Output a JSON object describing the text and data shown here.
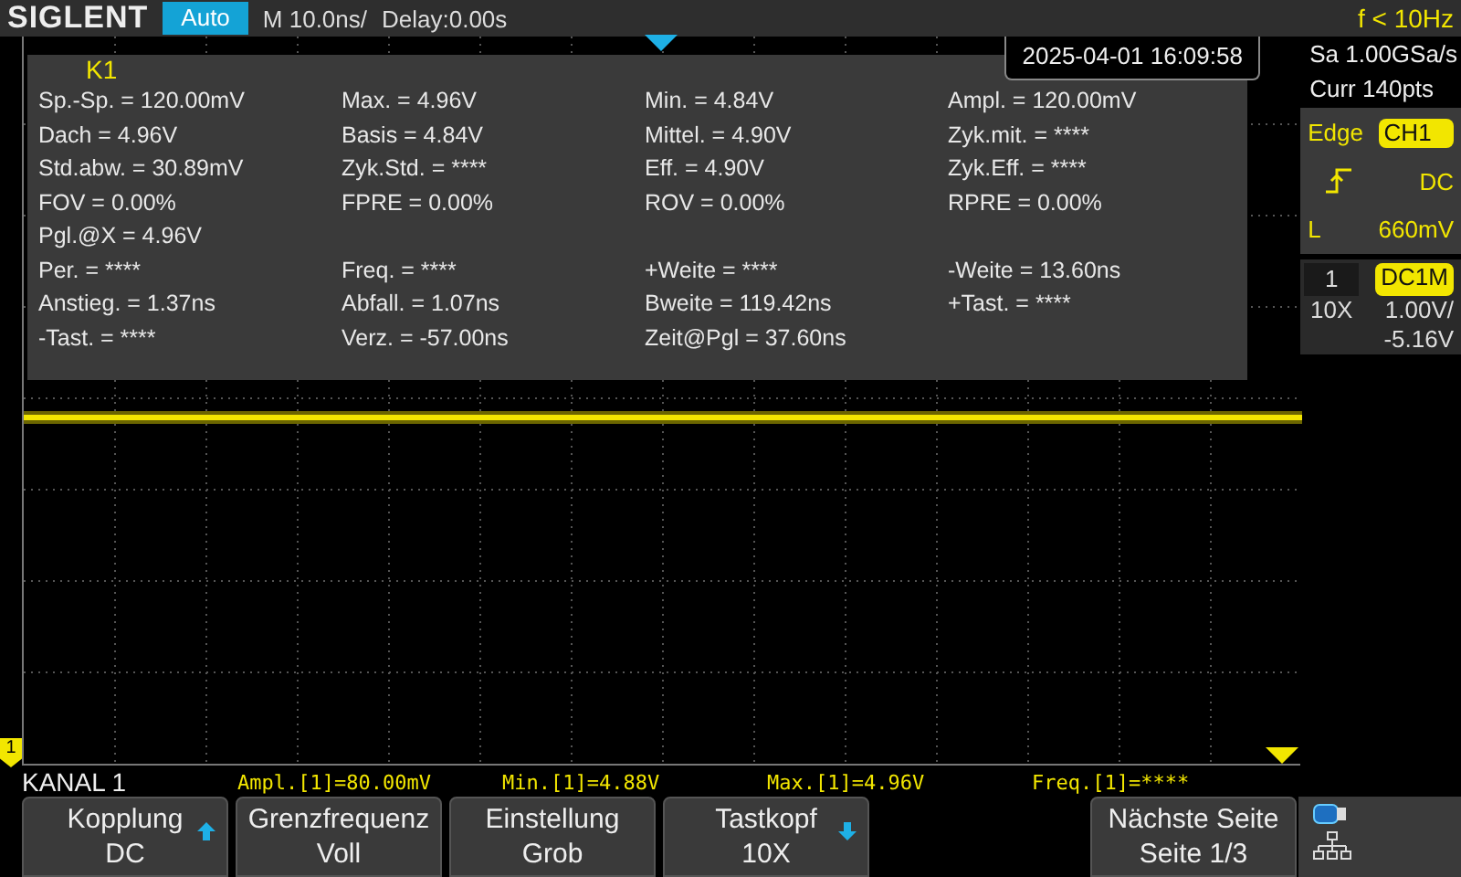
{
  "top_bar": {
    "logo": "SIGLENT",
    "mode": "Auto",
    "timebase": "M 10.0ns/",
    "delay": "Delay:0.00s",
    "frequency": "f < 10Hz"
  },
  "timestamp": "2025-04-01 16:09:58",
  "measurements": {
    "title": "K1",
    "rows": [
      [
        "Sp.-Sp. = 120.00mV",
        "Max. = 4.96V",
        "Min. = 4.84V",
        "Ampl. = 120.00mV"
      ],
      [
        "Dach = 4.96V",
        "Basis = 4.84V",
        "Mittel. = 4.90V",
        "Zyk.mit. = ****"
      ],
      [
        "Std.abw. = 30.89mV",
        "Zyk.Std. = ****",
        "Eff. = 4.90V",
        "Zyk.Eff. = ****"
      ],
      [
        "FOV = 0.00%",
        "FPRE = 0.00%",
        "ROV = 0.00%",
        "RPRE = 0.00%"
      ],
      [
        "Pgl.@X = 4.96V"
      ],
      [
        "Per. = ****",
        "Freq. = ****",
        "+Weite = ****",
        "-Weite = 13.60ns"
      ],
      [
        "Anstieg. = 1.37ns",
        "Abfall. = 1.07ns",
        "Bweite = 119.42ns",
        "+Tast. = ****"
      ],
      [
        "-Tast. = ****",
        "Verz. = -57.00ns",
        "Zeit@Pgl = 37.60ns"
      ]
    ]
  },
  "channel_marker": "1",
  "right_panel": {
    "sample_rate": "Sa 1.00GSa/s",
    "memory": "Curr 140pts",
    "trigger": {
      "type": "Edge",
      "source": "CH1",
      "coupling": "DC",
      "level_label": "L",
      "level": "660mV"
    },
    "channel": {
      "number": "1",
      "coupling": "DC1M",
      "probe": "10X",
      "scale": "1.00V/",
      "offset": "-5.16V"
    }
  },
  "status_bar": {
    "channel": "KANAL 1",
    "readouts": [
      "Ampl.[1]=80.00mV",
      "Min.[1]=4.88V",
      "Max.[1]=4.96V",
      "Freq.[1]=****"
    ]
  },
  "softkeys": [
    {
      "kind": "menu",
      "label": "Kopplung",
      "value": "DC",
      "arrow_up": true,
      "arrow_down": false
    },
    {
      "kind": "menu",
      "label": "Grenzfrequenz",
      "value": "Voll",
      "arrow_up": false,
      "arrow_down": false
    },
    {
      "kind": "menu",
      "label": "Einstellung",
      "value": "Grob",
      "arrow_up": false,
      "arrow_down": false
    },
    {
      "kind": "menu",
      "label": "Tastkopf",
      "value": "10X",
      "arrow_up": false,
      "arrow_down": true
    },
    {
      "kind": "page",
      "label": "Nächste Seite",
      "value": "Seite 1/3",
      "arrow_up": false,
      "arrow_down": false
    }
  ]
}
